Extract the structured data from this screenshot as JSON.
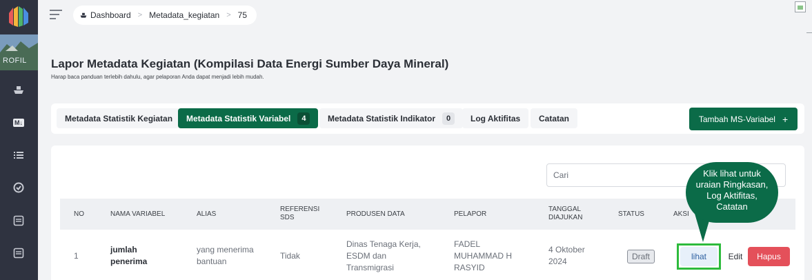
{
  "sidebar": {
    "profile_text": "ROFIL",
    "icons": [
      "ship-icon",
      "markdown-icon",
      "list-icon",
      "check-circle-icon",
      "document-icon",
      "document-icon"
    ],
    "markdown_label": "M↓"
  },
  "breadcrumb": {
    "items": [
      "Dashboard",
      "Metadata_kegiatan",
      "75"
    ]
  },
  "page": {
    "title": "Lapor Metadata Kegiatan (Kompilasi Data Energi Sumber Daya Mineral)",
    "subtitle": "Harap baca panduan terlebih dahulu, agar pelaporan Anda dapat menjadi lebih mudah."
  },
  "tabs": [
    {
      "label": "Metadata Statistik Kegiatan",
      "count": null,
      "active": false
    },
    {
      "label": "Metadata Statistik Variabel",
      "count": "4",
      "active": true
    },
    {
      "label": "Metadata Statistik Indikator",
      "count": "0",
      "active": false
    },
    {
      "label": "Log Aktifitas",
      "count": null,
      "active": false
    },
    {
      "label": "Catatan",
      "count": null,
      "active": false
    }
  ],
  "add_button": {
    "label": "Tambah MS-Variabel",
    "icon": "plus-icon"
  },
  "search": {
    "placeholder": "Cari"
  },
  "table": {
    "headers": {
      "no": "NO",
      "nama": "NAMA VARIABEL",
      "alias": "ALIAS",
      "referensi": [
        "REFERENSI",
        "SDS"
      ],
      "produsen": "PRODUSEN DATA",
      "pelapor": "PELAPOR",
      "tanggal": [
        "TANGGAL",
        "DIAJUKAN"
      ],
      "status": "STATUS",
      "aksi": "AKSI"
    },
    "rows": [
      {
        "no": "1",
        "nama": [
          "jumlah",
          "penerima"
        ],
        "alias": [
          "yang menerima",
          "bantuan"
        ],
        "referensi": "Tidak",
        "produsen": [
          "Dinas Tenaga Kerja,",
          "ESDM dan",
          "Transmigrasi"
        ],
        "pelapor": [
          "FADEL",
          "MUHAMMAD H",
          "RASYID"
        ],
        "tanggal": [
          "4 Oktober",
          "2024"
        ],
        "status": "Draft",
        "actions": {
          "lihat": "lihat",
          "edit": "Edit",
          "hapus": "Hapus"
        }
      }
    ]
  },
  "tooltip": {
    "lines": [
      "Klik lihat untuk",
      "uraian Ringkasan,",
      "Log Aktifitas,",
      "Catatan"
    ]
  },
  "colors": {
    "primary": "#0b6b48",
    "danger": "#e4505a",
    "highlight": "#2dbb3c",
    "sidebar": "#2f3340"
  }
}
